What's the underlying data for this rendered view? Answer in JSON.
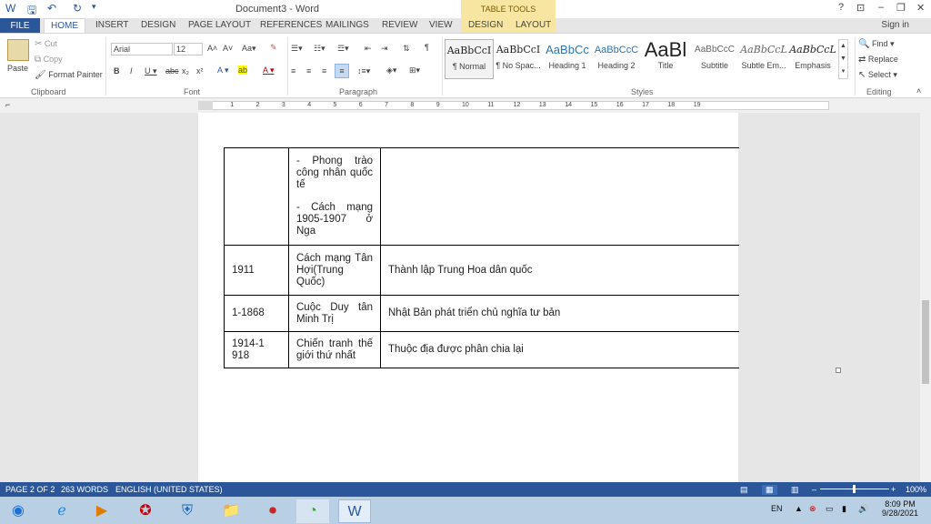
{
  "titlebar": {
    "title": "Document3 - Word",
    "table_tools": "TABLE TOOLS",
    "help": "?",
    "restore_ribbon": "⊡",
    "minimize": "–",
    "maximize": "❐",
    "close": "✕"
  },
  "tabs": [
    "FILE",
    "HOME",
    "INSERT",
    "DESIGN",
    "PAGE LAYOUT",
    "REFERENCES",
    "MAILINGS",
    "REVIEW",
    "VIEW",
    "DESIGN",
    "LAYOUT"
  ],
  "signin": "Sign in",
  "ribbon": {
    "clipboard": {
      "paste": "Paste",
      "cut": "Cut",
      "copy": "Copy",
      "format_painter": "Format Painter",
      "label": "Clipboard"
    },
    "font": {
      "name": "Arial",
      "size": "12",
      "label": "Font"
    },
    "paragraph": {
      "label": "Paragraph"
    },
    "styles": {
      "label": "Styles",
      "items": [
        {
          "preview": "AaBbCcI",
          "name": "¶ Normal"
        },
        {
          "preview": "AaBbCcI",
          "name": "¶ No Spac..."
        },
        {
          "preview": "AaBbCc",
          "name": "Heading 1"
        },
        {
          "preview": "AaBbCcC",
          "name": "Heading 2"
        },
        {
          "preview": "AaBl",
          "name": "Title"
        },
        {
          "preview": "AaBbCcC",
          "name": "Subtitle"
        },
        {
          "preview": "AaBbCcL",
          "name": "Subtle Em..."
        },
        {
          "preview": "AaBbCcL",
          "name": "Emphasis"
        }
      ]
    },
    "editing": {
      "find": "Find",
      "replace": "Replace",
      "select": "Select",
      "label": "Editing"
    }
  },
  "ruler": {
    "ticks": [
      "1",
      "1",
      "2",
      "3",
      "4",
      "5",
      "6",
      "7",
      "8",
      "9",
      "10",
      "11",
      "12",
      "13",
      "14",
      "15",
      "16",
      "17",
      "18",
      "19"
    ]
  },
  "table": {
    "rows": [
      {
        "year": "",
        "event": [
          "- Phong trào công nhân quốc tế",
          "- Cách mạng 1905-1907 ở Nga"
        ],
        "result": ""
      },
      {
        "year": "1911",
        "event": [
          "Cách mạng Tân Hợi(Trung Quốc)"
        ],
        "result": "Thành lập Trung Hoa dân quốc"
      },
      {
        "year": "1-1868",
        "event": [
          "Cuộc Duy tân Minh Trị"
        ],
        "result": "Nhật Bản phát triển chủ nghĩa tư bản"
      },
      {
        "year": "1914-1918",
        "event": [
          "Chiến tranh thế giới thứ nhất"
        ],
        "result": "Thuộc địa được phân chia lại"
      }
    ]
  },
  "statusbar": {
    "page": "PAGE 2 OF 2",
    "words": "263 WORDS",
    "language": "ENGLISH (UNITED STATES)",
    "zoom": "100%"
  },
  "taskbar": {
    "lang": "EN",
    "time": "8:09 PM",
    "date": "9/28/2021"
  },
  "colors": {
    "accent": "#2b579a",
    "table_tools": "#f7e6a2"
  }
}
